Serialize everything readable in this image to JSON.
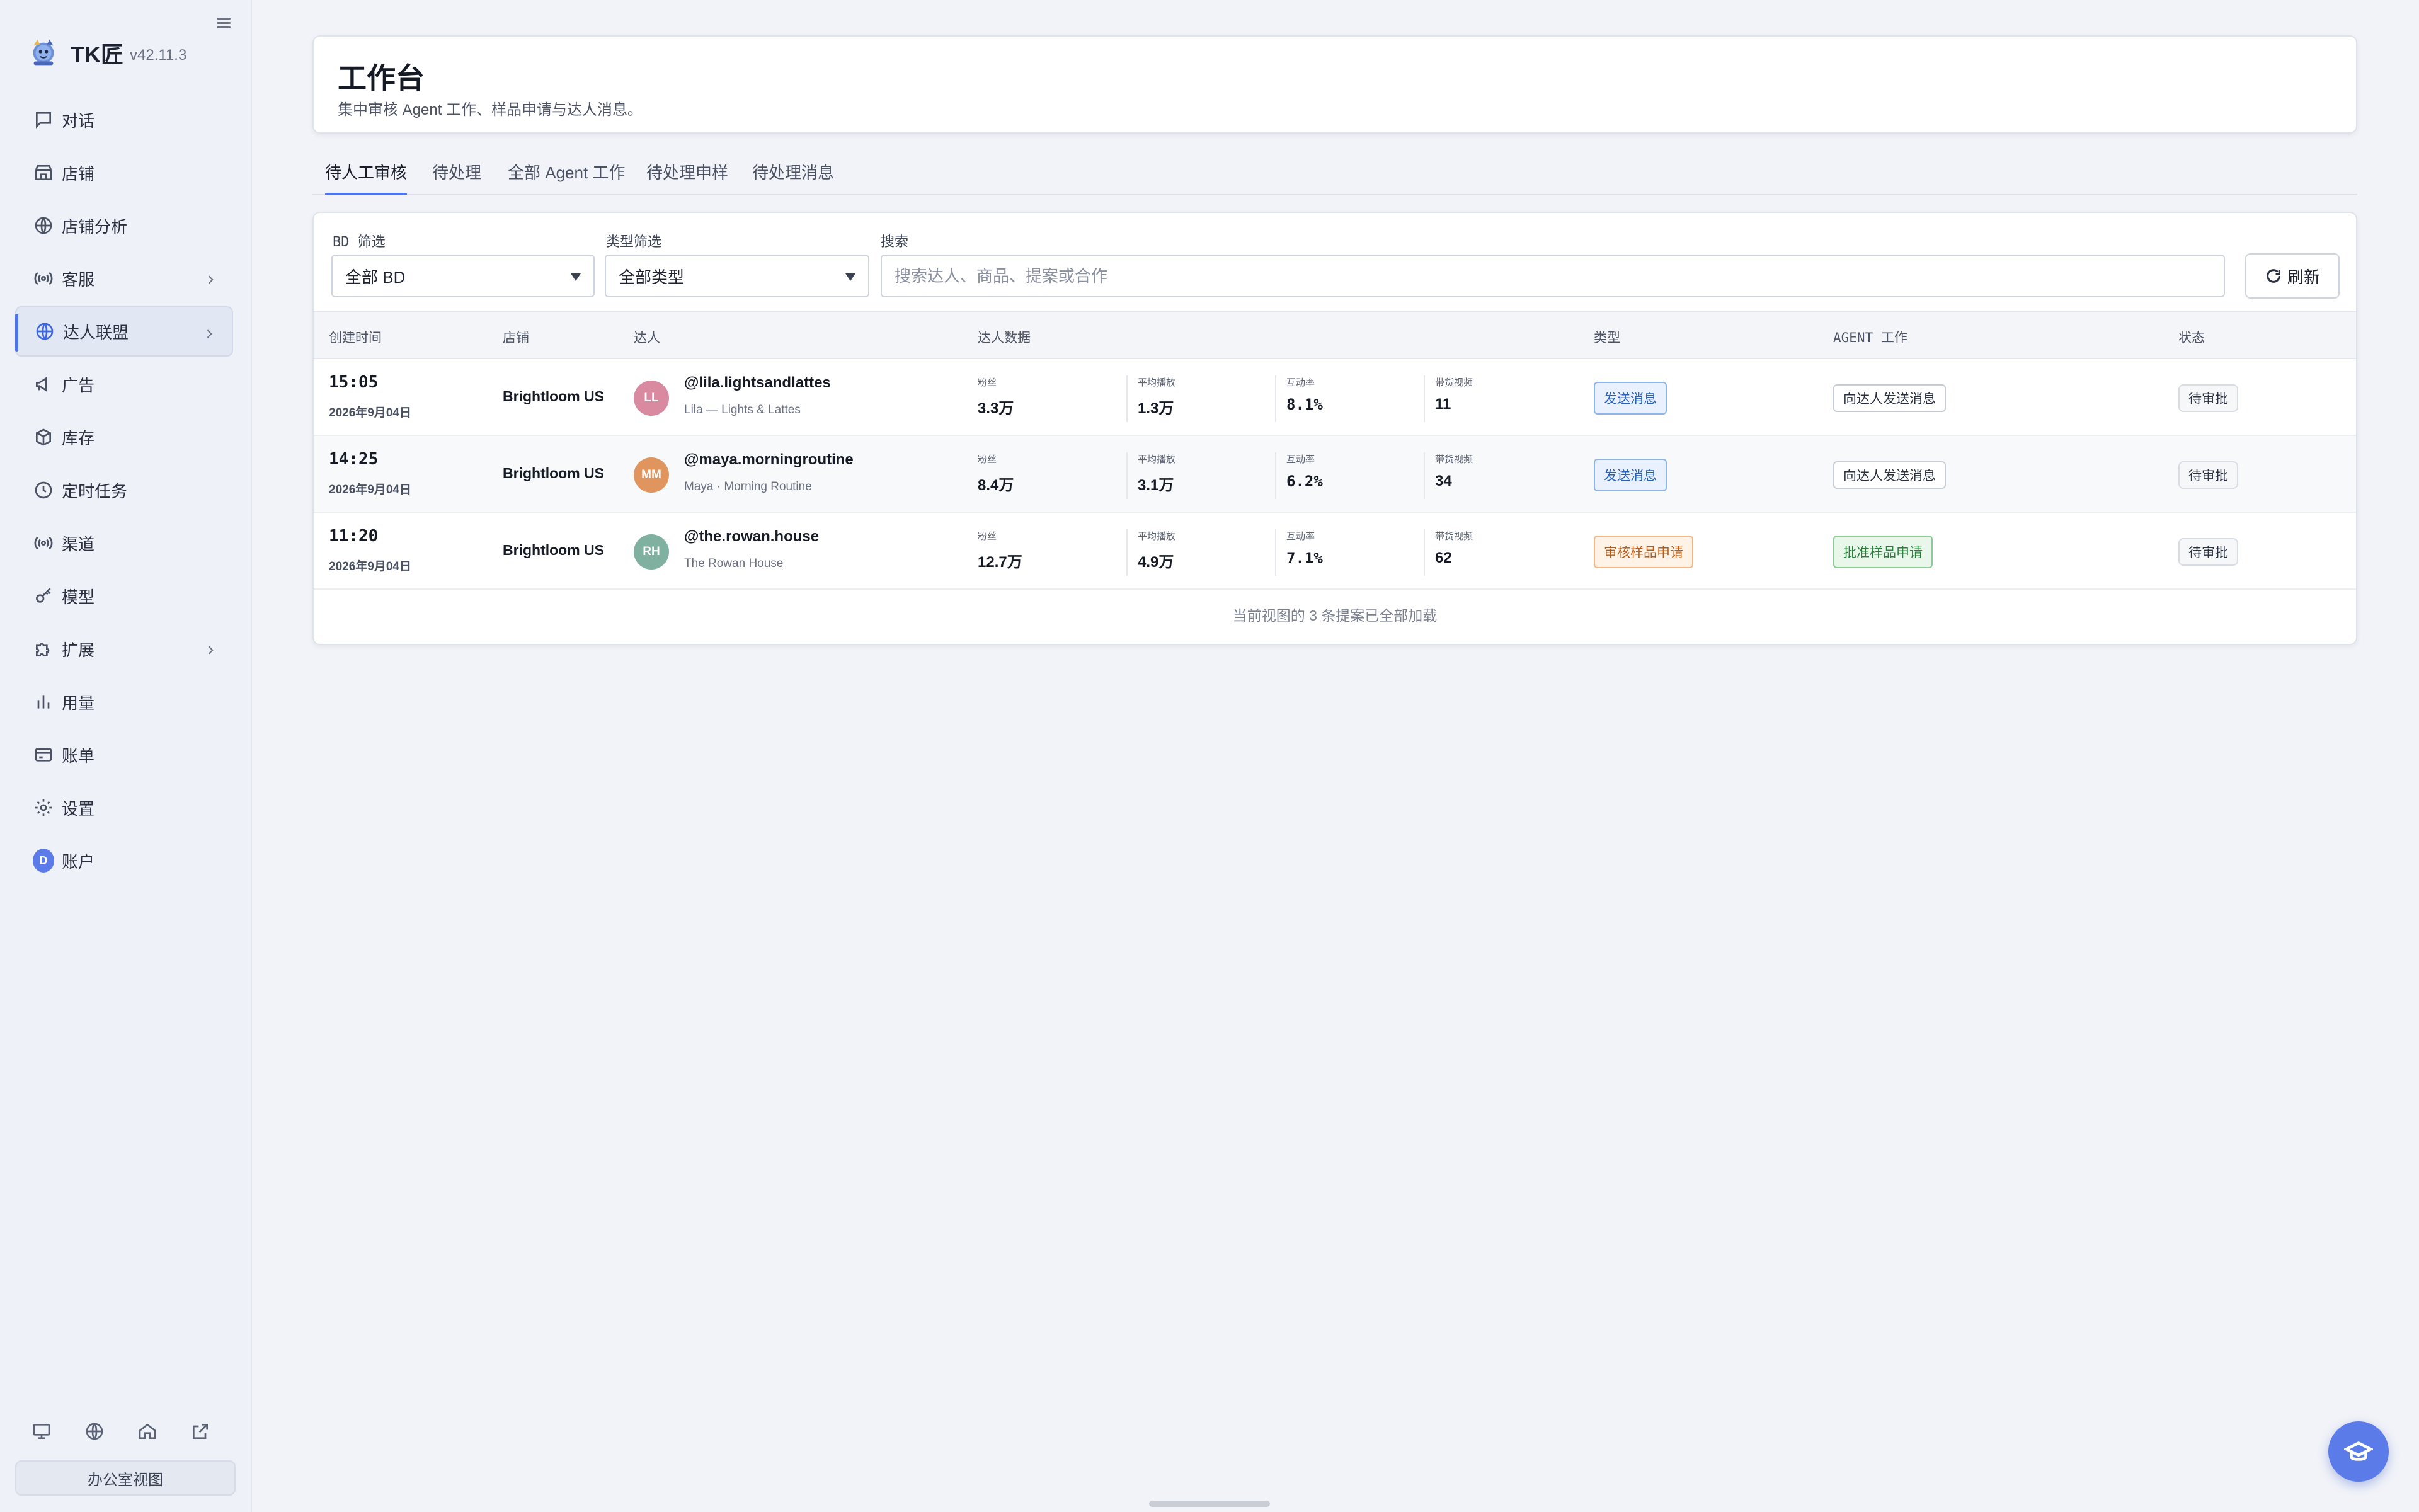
{
  "app": {
    "name": "TK匠",
    "version": "v42.11.3"
  },
  "sidebar": {
    "items": [
      {
        "label": "对话",
        "icon": "chat-icon"
      },
      {
        "label": "店铺",
        "icon": "store-icon"
      },
      {
        "label": "店铺分析",
        "icon": "globe-icon"
      },
      {
        "label": "客服",
        "icon": "broadcast-icon",
        "expandable": true
      },
      {
        "label": "达人联盟",
        "icon": "globe-icon",
        "expandable": true,
        "active": true
      },
      {
        "label": "广告",
        "icon": "megaphone-icon"
      },
      {
        "label": "库存",
        "icon": "box-icon"
      },
      {
        "label": "定时任务",
        "icon": "clock-icon"
      },
      {
        "label": "渠道",
        "icon": "broadcast-icon"
      },
      {
        "label": "模型",
        "icon": "key-icon"
      },
      {
        "label": "扩展",
        "icon": "puzzle-icon",
        "expandable": true
      },
      {
        "label": "用量",
        "icon": "bar-chart-icon"
      },
      {
        "label": "账单",
        "icon": "credit-card-icon"
      },
      {
        "label": "设置",
        "icon": "gear-icon"
      },
      {
        "label": "账户",
        "icon": "avatar",
        "avatar_letter": "D"
      }
    ],
    "bottom_icons": [
      "monitor-icon",
      "globe-icon",
      "home-icon",
      "external-link-icon"
    ],
    "office_view_label": "办公室视图"
  },
  "header": {
    "title": "工作台",
    "subtitle": "集中审核 Agent 工作、样品申请与达人消息。"
  },
  "tabs": [
    {
      "label": "待人工审核",
      "active": true
    },
    {
      "label": "待处理"
    },
    {
      "label": "全部 Agent 工作"
    },
    {
      "label": "待处理申样"
    },
    {
      "label": "待处理消息"
    }
  ],
  "filters": {
    "bd_label": "BD 筛选",
    "bd_value": "全部 BD",
    "type_label": "类型筛选",
    "type_value": "全部类型",
    "search_label": "搜索",
    "search_placeholder": "搜索达人、商品、提案或合作",
    "refresh_label": "刷新"
  },
  "table": {
    "columns": [
      "创建时间",
      "店铺",
      "达人",
      "达人数据",
      "类型",
      "AGENT 工作",
      "状态"
    ],
    "metric_labels": [
      "粉丝",
      "平均播放",
      "互动率",
      "带货视频"
    ],
    "rows": [
      {
        "time": "15:05",
        "date": "2026年9月04日",
        "store": "Brightloom US",
        "initials": "LL",
        "avatar_color": "#d98aa0",
        "handle": "@lila.lightsandlattes",
        "name": "Lila — Lights & Lattes",
        "metrics": [
          "3.3万",
          "1.3万",
          "8.1%",
          "11"
        ],
        "type": "发送消息",
        "type_style": "blue",
        "agent_work": "向达人发送消息",
        "agent_style": "plain",
        "status": "待审批"
      },
      {
        "time": "14:25",
        "date": "2026年9月04日",
        "store": "Brightloom US",
        "initials": "MM",
        "avatar_color": "#e0955e",
        "handle": "@maya.morningroutine",
        "name": "Maya · Morning Routine",
        "metrics": [
          "8.4万",
          "3.1万",
          "6.2%",
          "34"
        ],
        "type": "发送消息",
        "type_style": "blue",
        "agent_work": "向达人发送消息",
        "agent_style": "plain",
        "status": "待审批"
      },
      {
        "time": "11:20",
        "date": "2026年9月04日",
        "store": "Brightloom US",
        "initials": "RH",
        "avatar_color": "#7fb0a0",
        "handle": "@the.rowan.house",
        "name": "The Rowan House",
        "metrics": [
          "12.7万",
          "4.9万",
          "7.1%",
          "62"
        ],
        "type": "审核样品申请",
        "type_style": "orange",
        "agent_work": "批准样品申请",
        "agent_style": "green",
        "status": "待审批"
      }
    ],
    "footer_note": "当前视图的 3 条提案已全部加载"
  },
  "colors": {
    "accent": "#4f74e6",
    "fab": "#5b7be8"
  },
  "fab_icon": "graduation-cap-icon"
}
